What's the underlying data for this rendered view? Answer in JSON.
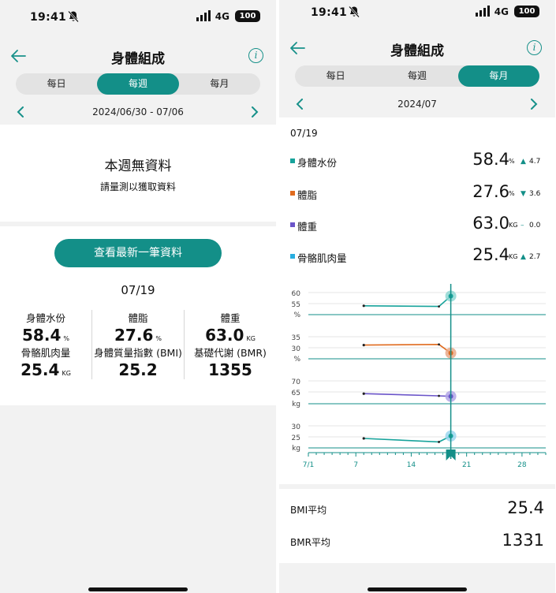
{
  "status_bar": {
    "time": "19:41",
    "network": "4G",
    "battery": "100"
  },
  "left": {
    "title": "身體組成",
    "tabs": [
      {
        "label": "每日"
      },
      {
        "label": "每週"
      },
      {
        "label": "每月"
      }
    ],
    "active_tab": 1,
    "date_range": "2024/06/30 - 07/06",
    "no_data_title": "本週無資料",
    "no_data_subtitle": "請量測以獲取資料",
    "latest_button": "查看最新一筆資料",
    "latest_date": "07/19",
    "metrics": [
      {
        "label": "身體水份",
        "value": "58.4",
        "unit": "%"
      },
      {
        "label": "體脂",
        "value": "27.6",
        "unit": "%"
      },
      {
        "label": "體重",
        "value": "63.0",
        "unit": "KG"
      },
      {
        "label": "骨骼肌肉量",
        "value": "25.4",
        "unit": "KG"
      },
      {
        "label": "身體質量指數 (BMI)",
        "value": "25.2",
        "unit": ""
      },
      {
        "label": "基礎代謝 (BMR)",
        "value": "1355",
        "unit": ""
      }
    ]
  },
  "right": {
    "title": "身體組成",
    "tabs": [
      {
        "label": "每日"
      },
      {
        "label": "每週"
      },
      {
        "label": "每月"
      }
    ],
    "active_tab": 2,
    "month": "2024/07",
    "selected_date": "07/19",
    "metrics": [
      {
        "name": "身體水份",
        "value": "58.4",
        "unit": "%",
        "trend": "▲",
        "delta": "4.7",
        "color": "#17a39b"
      },
      {
        "name": "體脂",
        "value": "27.6",
        "unit": "%",
        "trend": "▼",
        "delta": "3.6",
        "color": "#e06b1f"
      },
      {
        "name": "體重",
        "value": "63.0",
        "unit": "KG",
        "trend": "–",
        "delta": "0.0",
        "color": "#6b55c9"
      },
      {
        "name": "骨骼肌肉量",
        "value": "25.4",
        "unit": "KG",
        "trend": "▲",
        "delta": "2.7",
        "color": "#29aee0"
      }
    ],
    "bmi_label": "BMI平均",
    "bmi_value": "25.4",
    "bmr_label": "BMR平均",
    "bmr_value": "1331"
  },
  "chart_data": {
    "type": "line",
    "x_ticks": [
      "7/1",
      "7",
      "14",
      "21",
      "28"
    ],
    "x_range": [
      1,
      31
    ],
    "selected_day": 19,
    "panels": [
      {
        "metric": "身體水份",
        "unit": "%",
        "y_ticks": [
          60,
          55
        ],
        "y_range": [
          50,
          62
        ],
        "color": "#17a39b",
        "marker_color": "#8fd7d2",
        "points": [
          {
            "x": 8,
            "y": 54.0
          },
          {
            "x": 17.5,
            "y": 53.7
          },
          {
            "x": 19,
            "y": 58.4
          }
        ]
      },
      {
        "metric": "體脂",
        "unit": "%",
        "y_ticks": [
          35,
          30
        ],
        "y_range": [
          25,
          37
        ],
        "color": "#e06b1f",
        "marker_color": "#e9a98a",
        "points": [
          {
            "x": 8,
            "y": 31.2
          },
          {
            "x": 17.5,
            "y": 31.5
          },
          {
            "x": 19,
            "y": 27.6
          }
        ]
      },
      {
        "metric": "體重",
        "unit": "kg",
        "y_ticks": [
          70,
          65
        ],
        "y_range": [
          60,
          72
        ],
        "color": "#6b55c9",
        "marker_color": "#b1a4e6",
        "points": [
          {
            "x": 8,
            "y": 64.2
          },
          {
            "x": 17.5,
            "y": 63.2
          },
          {
            "x": 19,
            "y": 63.0
          }
        ]
      },
      {
        "metric": "骨骼肌肉量",
        "unit": "kg",
        "y_ticks": [
          30,
          25
        ],
        "y_range": [
          20,
          32
        ],
        "color": "#17a39b",
        "marker_color": "#9bd6ee",
        "points": [
          {
            "x": 8,
            "y": 24.3
          },
          {
            "x": 17.5,
            "y": 22.7
          },
          {
            "x": 19,
            "y": 25.4
          }
        ]
      }
    ]
  }
}
